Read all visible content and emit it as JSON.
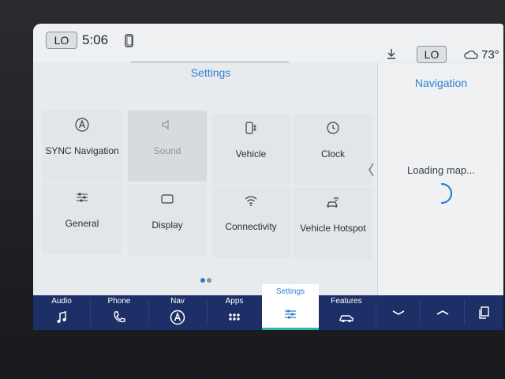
{
  "status_bar": {
    "fan_left": "LO",
    "time": "5:06",
    "fan_right": "LO",
    "temperature": "73°",
    "icons": [
      "phone-icon",
      "download-icon",
      "cloud-weather-icon"
    ]
  },
  "settings": {
    "title": "Settings",
    "tiles": [
      {
        "label": "SYNC Navigation",
        "icon": "nav-a-icon"
      },
      {
        "label": "Sound",
        "icon": "speaker-icon"
      },
      {
        "label": "Vehicle",
        "icon": "vehicle-icon"
      },
      {
        "label": "Clock",
        "icon": "clock-icon"
      },
      {
        "label": "General",
        "icon": "sliders-icon"
      },
      {
        "label": "Display",
        "icon": "display-icon"
      },
      {
        "label": "Connectivity",
        "icon": "wifi-icon"
      },
      {
        "label": "Vehicle Hotspot",
        "icon": "hotspot-icon"
      }
    ],
    "page_indicator": {
      "current": 1,
      "total": 2
    }
  },
  "navigation": {
    "title": "Navigation",
    "status": "Loading map..."
  },
  "dock": {
    "items": [
      {
        "label": "Audio",
        "icon": "music-note-icon"
      },
      {
        "label": "Phone",
        "icon": "phone-handset-icon"
      },
      {
        "label": "Nav",
        "icon": "nav-a-icon"
      },
      {
        "label": "Apps",
        "icon": "apps-grid-icon"
      },
      {
        "label": "Settings",
        "icon": "settings-sliders-icon"
      },
      {
        "label": "Features",
        "icon": "car-features-icon"
      }
    ],
    "active": "Settings"
  },
  "colors": {
    "accent": "#2f7fd0",
    "dock_bg": "#1c2f66",
    "active_underline": "#2fb5a0"
  }
}
